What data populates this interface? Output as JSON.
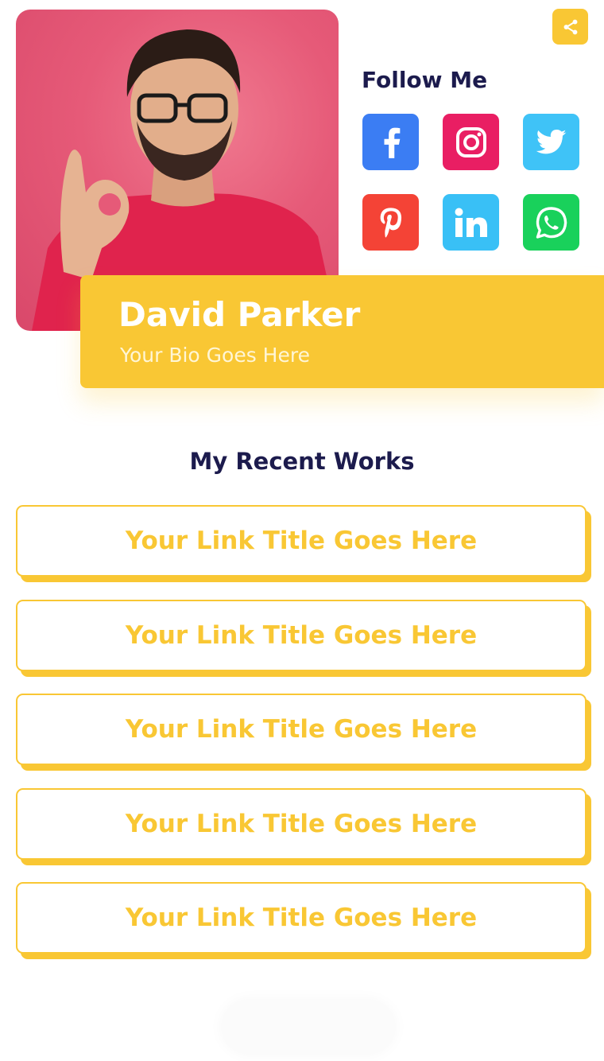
{
  "profile": {
    "name": "David Parker",
    "bio": "Your Bio Goes Here"
  },
  "follow": {
    "title": "Follow Me",
    "icons": [
      "facebook-icon",
      "instagram-icon",
      "twitter-icon",
      "pinterest-icon",
      "linkedin-icon",
      "whatsapp-icon"
    ]
  },
  "colors": {
    "accent": "#f9c734",
    "title": "#1c1b4d",
    "facebook": "#3b7df3",
    "instagram": "#e91e63",
    "twitter": "#3fc3f7",
    "pinterest": "#f44336",
    "linkedin": "#39c0f6",
    "whatsapp": "#19d15b"
  },
  "works": {
    "title": "My Recent Works",
    "links": [
      "Your Link Title Goes Here",
      "Your Link Title Goes Here",
      "Your Link Title Goes Here",
      "Your Link Title Goes Here",
      "Your Link Title Goes Here"
    ]
  }
}
